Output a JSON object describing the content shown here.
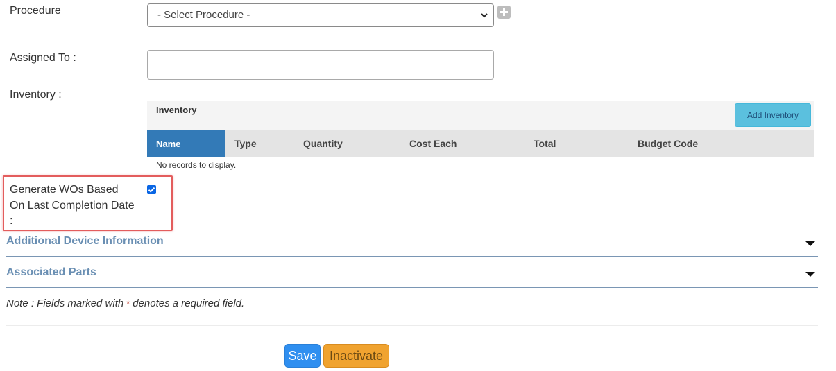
{
  "form": {
    "procedure": {
      "label": "Procedure",
      "selected": "- Select Procedure -",
      "add_icon": "plus-icon"
    },
    "assigned_to": {
      "label": "Assigned To :",
      "value": ""
    },
    "inventory": {
      "label": "Inventory :",
      "panel_title": "Inventory",
      "add_button": "Add Inventory",
      "columns": [
        "Name",
        "Type",
        "Quantity",
        "Cost Each",
        "Total",
        "Budget Code"
      ],
      "active_column": "Name",
      "empty_message": "No records to display."
    },
    "generate_wos": {
      "label": "Generate WOs Based On Last Completion Date :",
      "checked": true,
      "highlight_color": "#e35d5d"
    }
  },
  "sections": [
    {
      "title": "Additional Device Information",
      "icon": "caret-down-icon"
    },
    {
      "title": "Associated Parts",
      "icon": "caret-down-icon"
    }
  ],
  "note": {
    "prefix": "Note : Fields marked with ",
    "marker": "*",
    "suffix": " denotes a required field."
  },
  "actions": {
    "save": "Save",
    "inactivate": "Inactivate"
  },
  "colors": {
    "primary": "#337ab7",
    "info": "#5bc0de",
    "save": "#2f8ff0",
    "inactivate": "#f0a330",
    "section_title": "#6a8fb3"
  }
}
